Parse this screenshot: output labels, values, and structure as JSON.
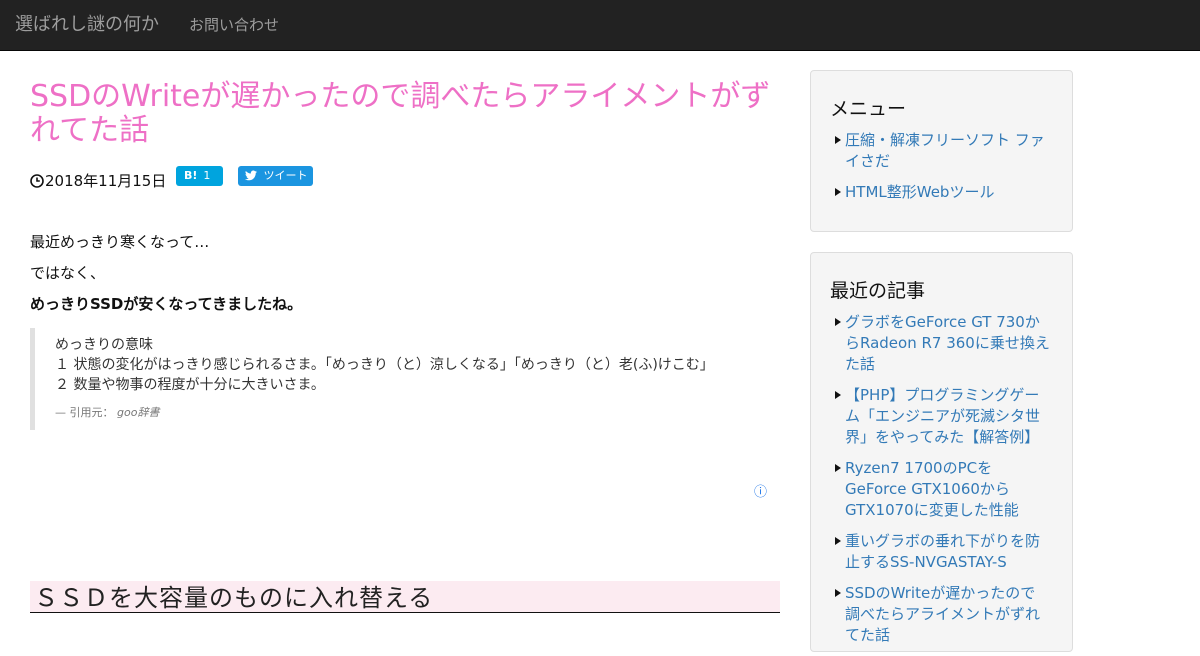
{
  "navbar": {
    "brand": "選ばれし謎の何か",
    "contact": "お問い合わせ"
  },
  "post": {
    "title": "SSDのWriteが遅かったので調べたらアライメントがずれてた話",
    "date": "2018年11月15日",
    "hatena_label": "B!",
    "hatena_count": "1",
    "tweet_label": "ツイート",
    "paragraphs": [
      "最近めっきり寒くなって…",
      "ではなく、",
      "めっきりSSDが安くなってきましたね。"
    ],
    "quote": {
      "lines": [
        "めっきりの意味",
        "１ 状態の変化がはっきり感じられるさま。「めっきり（と）涼しくなる」「めっきり（と）老(ふ)けこむ」",
        "２ 数量や物事の程度が十分に大きいさま。"
      ],
      "cite_prefix": "— 引用元：",
      "cite_source": "goo辞書"
    },
    "ad_info": "ⓘ",
    "section_heading": "ＳＳＤを大容量のものに入れ替える"
  },
  "sidebar": {
    "menu": {
      "title": "メニュー",
      "items": [
        "圧縮・解凍フリーソフト ファイさだ",
        "HTML整形Webツール"
      ]
    },
    "recent": {
      "title": "最近の記事",
      "items": [
        "グラボをGeForce GT 730からRadeon R7 360に乗せ換えた話",
        "【PHP】プログラミングゲーム「エンジニアが死滅シタ世界」をやってみた【解答例】",
        "Ryzen7 1700のPCをGeForce GTX1060からGTX1070に変更した性能",
        "重いグラボの垂れ下がりを防止するSS-NVGASTAY-S",
        "SSDのWriteが遅かったので調べたらアライメントがずれてた話"
      ]
    }
  },
  "colors": {
    "navbar_bg": "#222222",
    "title_pink": "#ee70c6",
    "link_blue": "#337ab7",
    "hatena_blue": "#00a4de",
    "twitter_blue": "#1b95e0",
    "heading_bg": "#fcebf1"
  }
}
